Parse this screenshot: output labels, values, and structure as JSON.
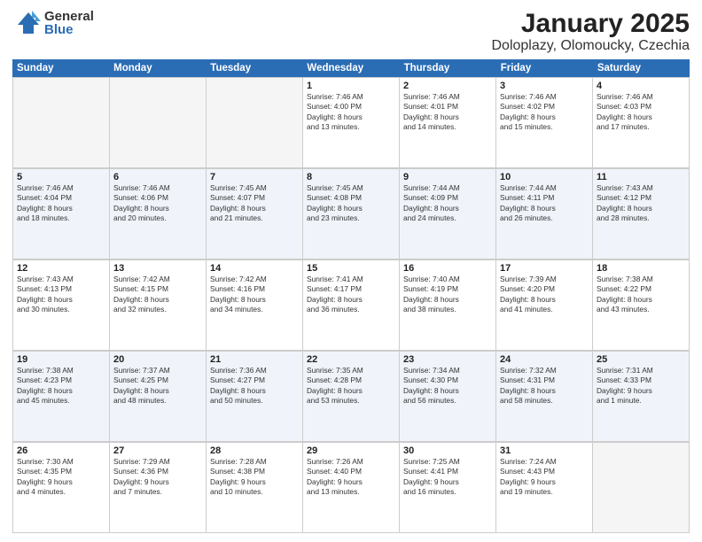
{
  "logo": {
    "general": "General",
    "blue": "Blue"
  },
  "title": "January 2025",
  "subtitle": "Doloplazy, Olomoucky, Czechia",
  "weekdays": [
    "Sunday",
    "Monday",
    "Tuesday",
    "Wednesday",
    "Thursday",
    "Friday",
    "Saturday"
  ],
  "weeks": [
    [
      {
        "day": "",
        "text": "",
        "empty": true
      },
      {
        "day": "",
        "text": "",
        "empty": true
      },
      {
        "day": "",
        "text": "",
        "empty": true
      },
      {
        "day": "1",
        "text": "Sunrise: 7:46 AM\nSunset: 4:00 PM\nDaylight: 8 hours\nand 13 minutes."
      },
      {
        "day": "2",
        "text": "Sunrise: 7:46 AM\nSunset: 4:01 PM\nDaylight: 8 hours\nand 14 minutes."
      },
      {
        "day": "3",
        "text": "Sunrise: 7:46 AM\nSunset: 4:02 PM\nDaylight: 8 hours\nand 15 minutes."
      },
      {
        "day": "4",
        "text": "Sunrise: 7:46 AM\nSunset: 4:03 PM\nDaylight: 8 hours\nand 17 minutes."
      }
    ],
    [
      {
        "day": "5",
        "text": "Sunrise: 7:46 AM\nSunset: 4:04 PM\nDaylight: 8 hours\nand 18 minutes."
      },
      {
        "day": "6",
        "text": "Sunrise: 7:46 AM\nSunset: 4:06 PM\nDaylight: 8 hours\nand 20 minutes."
      },
      {
        "day": "7",
        "text": "Sunrise: 7:45 AM\nSunset: 4:07 PM\nDaylight: 8 hours\nand 21 minutes."
      },
      {
        "day": "8",
        "text": "Sunrise: 7:45 AM\nSunset: 4:08 PM\nDaylight: 8 hours\nand 23 minutes."
      },
      {
        "day": "9",
        "text": "Sunrise: 7:44 AM\nSunset: 4:09 PM\nDaylight: 8 hours\nand 24 minutes."
      },
      {
        "day": "10",
        "text": "Sunrise: 7:44 AM\nSunset: 4:11 PM\nDaylight: 8 hours\nand 26 minutes."
      },
      {
        "day": "11",
        "text": "Sunrise: 7:43 AM\nSunset: 4:12 PM\nDaylight: 8 hours\nand 28 minutes."
      }
    ],
    [
      {
        "day": "12",
        "text": "Sunrise: 7:43 AM\nSunset: 4:13 PM\nDaylight: 8 hours\nand 30 minutes."
      },
      {
        "day": "13",
        "text": "Sunrise: 7:42 AM\nSunset: 4:15 PM\nDaylight: 8 hours\nand 32 minutes."
      },
      {
        "day": "14",
        "text": "Sunrise: 7:42 AM\nSunset: 4:16 PM\nDaylight: 8 hours\nand 34 minutes."
      },
      {
        "day": "15",
        "text": "Sunrise: 7:41 AM\nSunset: 4:17 PM\nDaylight: 8 hours\nand 36 minutes."
      },
      {
        "day": "16",
        "text": "Sunrise: 7:40 AM\nSunset: 4:19 PM\nDaylight: 8 hours\nand 38 minutes."
      },
      {
        "day": "17",
        "text": "Sunrise: 7:39 AM\nSunset: 4:20 PM\nDaylight: 8 hours\nand 41 minutes."
      },
      {
        "day": "18",
        "text": "Sunrise: 7:38 AM\nSunset: 4:22 PM\nDaylight: 8 hours\nand 43 minutes."
      }
    ],
    [
      {
        "day": "19",
        "text": "Sunrise: 7:38 AM\nSunset: 4:23 PM\nDaylight: 8 hours\nand 45 minutes."
      },
      {
        "day": "20",
        "text": "Sunrise: 7:37 AM\nSunset: 4:25 PM\nDaylight: 8 hours\nand 48 minutes."
      },
      {
        "day": "21",
        "text": "Sunrise: 7:36 AM\nSunset: 4:27 PM\nDaylight: 8 hours\nand 50 minutes."
      },
      {
        "day": "22",
        "text": "Sunrise: 7:35 AM\nSunset: 4:28 PM\nDaylight: 8 hours\nand 53 minutes."
      },
      {
        "day": "23",
        "text": "Sunrise: 7:34 AM\nSunset: 4:30 PM\nDaylight: 8 hours\nand 56 minutes."
      },
      {
        "day": "24",
        "text": "Sunrise: 7:32 AM\nSunset: 4:31 PM\nDaylight: 8 hours\nand 58 minutes."
      },
      {
        "day": "25",
        "text": "Sunrise: 7:31 AM\nSunset: 4:33 PM\nDaylight: 9 hours\nand 1 minute."
      }
    ],
    [
      {
        "day": "26",
        "text": "Sunrise: 7:30 AM\nSunset: 4:35 PM\nDaylight: 9 hours\nand 4 minutes."
      },
      {
        "day": "27",
        "text": "Sunrise: 7:29 AM\nSunset: 4:36 PM\nDaylight: 9 hours\nand 7 minutes."
      },
      {
        "day": "28",
        "text": "Sunrise: 7:28 AM\nSunset: 4:38 PM\nDaylight: 9 hours\nand 10 minutes."
      },
      {
        "day": "29",
        "text": "Sunrise: 7:26 AM\nSunset: 4:40 PM\nDaylight: 9 hours\nand 13 minutes."
      },
      {
        "day": "30",
        "text": "Sunrise: 7:25 AM\nSunset: 4:41 PM\nDaylight: 9 hours\nand 16 minutes."
      },
      {
        "day": "31",
        "text": "Sunrise: 7:24 AM\nSunset: 4:43 PM\nDaylight: 9 hours\nand 19 minutes."
      },
      {
        "day": "",
        "text": "",
        "empty": true
      }
    ]
  ]
}
